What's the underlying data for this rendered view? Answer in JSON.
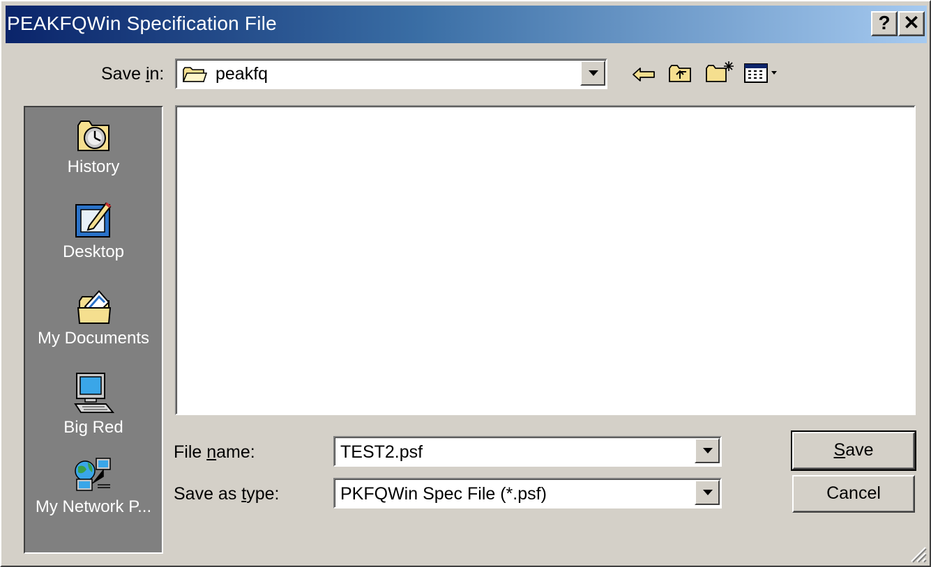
{
  "window": {
    "title": "PEAKFQWin Specification File",
    "help_label": "?",
    "close_label": "✕"
  },
  "save_in": {
    "label_pre": "Save ",
    "label_key": "i",
    "label_post": "n:",
    "value": "peakfq",
    "folder_icon": "folder-icon"
  },
  "toolbar": {
    "icons": [
      "back-arrow-icon",
      "up-one-level-icon",
      "create-new-folder-icon",
      "view-menu-icon"
    ]
  },
  "places": [
    {
      "label": "History",
      "icon": "history-icon"
    },
    {
      "label": "Desktop",
      "icon": "desktop-icon"
    },
    {
      "label": "My Documents",
      "icon": "my-documents-icon"
    },
    {
      "label": "Big Red",
      "icon": "computer-icon"
    },
    {
      "label": "My Network P...",
      "icon": "network-places-icon"
    }
  ],
  "file_name": {
    "label_pre": "File ",
    "label_key": "n",
    "label_post": "ame:",
    "value": "TEST2.psf"
  },
  "save_type": {
    "label_pre": "Save as ",
    "label_key": "t",
    "label_post": "ype:",
    "value": "PKFQWin Spec File (*.psf)"
  },
  "buttons": {
    "save_key": "S",
    "save_rest": "ave",
    "cancel": "Cancel"
  },
  "colors": {
    "titlebar_start": "#0a246a",
    "titlebar_end": "#a6caf0",
    "face": "#d4d0c8",
    "places_bg": "#808080"
  }
}
